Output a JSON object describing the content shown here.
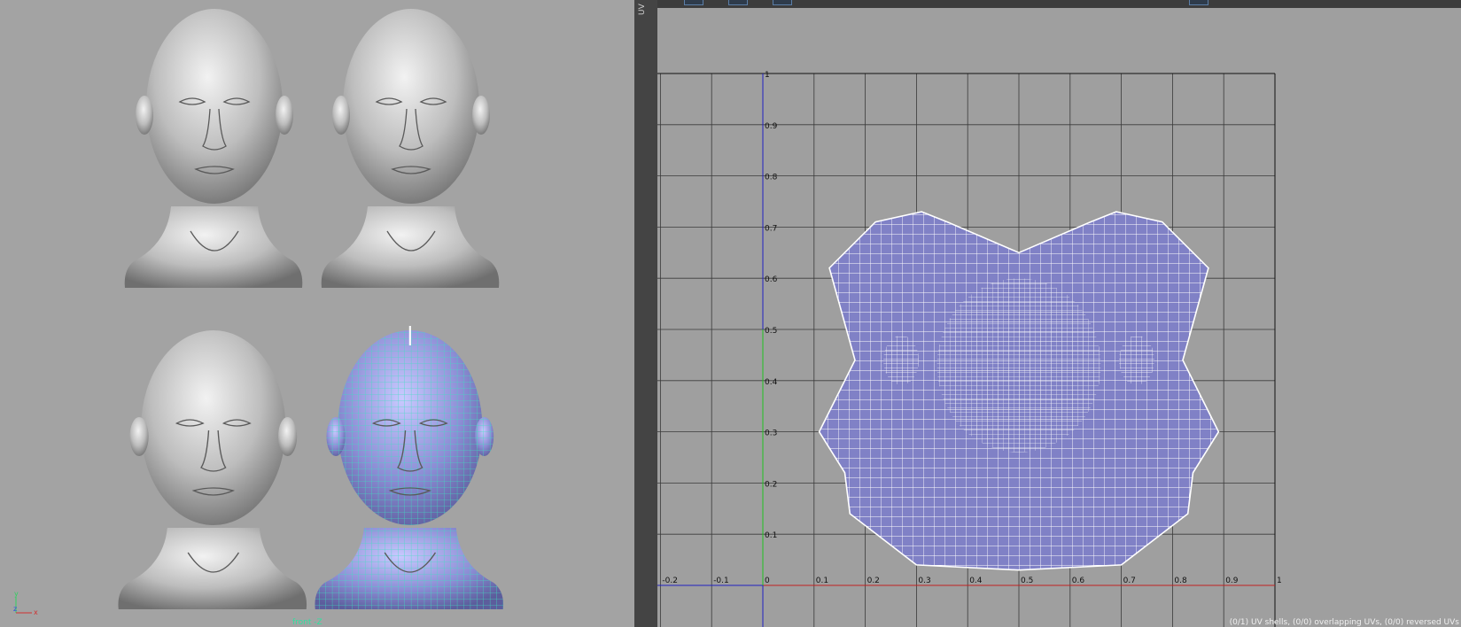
{
  "viewport": {
    "camera_label": "front -Z",
    "gizmo": {
      "y_label": "y",
      "z_label": "z",
      "x_label": "x"
    },
    "heads": [
      {
        "name": "female-head-1",
        "wireframe": false
      },
      {
        "name": "female-head-2",
        "wireframe": false
      },
      {
        "name": "male-head",
        "wireframe": false
      },
      {
        "name": "male-head-wireframe-selected",
        "wireframe": true
      }
    ]
  },
  "uv_editor": {
    "tab_label": "UV",
    "grid": {
      "u_ticks": [
        "-0.2",
        "-0.1",
        "0",
        "0.1",
        "0.2",
        "0.3",
        "0.4",
        "0.5",
        "0.6",
        "0.7",
        "0.8",
        "0.9",
        "1"
      ],
      "v_ticks": [
        "0.1",
        "0.2",
        "0.3",
        "0.4",
        "0.5",
        "0.6",
        "0.7",
        "0.8",
        "0.9",
        "1"
      ]
    },
    "status_text": "(0/1) UV shells, (0/0) overlapping UVs, (0/0) reversed UVs",
    "colors": {
      "shell_fill": "#8081c6",
      "u_axis": "#c02020",
      "v_axis": "#20c020",
      "origin_axis": "#2020c0",
      "grid": "#3a3a3a"
    }
  }
}
